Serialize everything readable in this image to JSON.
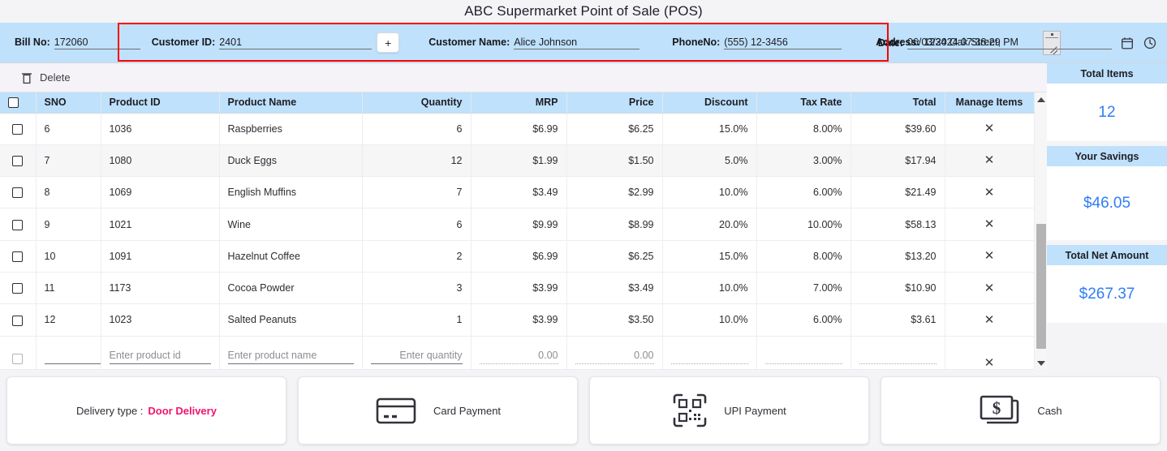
{
  "app": {
    "title": "ABC Supermarket Point of Sale (POS)"
  },
  "header": {
    "bill_no_label": "Bill No:",
    "bill_no_value": "172060",
    "customer_id_label": "Customer ID:",
    "customer_id_value": "2401",
    "add_customer_button": "+",
    "customer_name_label": "Customer Name:",
    "customer_name_value": "Alice Johnson",
    "phone_label": "PhoneNo:",
    "phone_value": "(555)  12-3456",
    "address_label": "Address:",
    "address_value": "1234 Oak Street,",
    "date_label": "Date:",
    "date_value": "06/03/2024 07:38:29 PM"
  },
  "toolbar": {
    "delete_label": "Delete"
  },
  "table": {
    "columns": [
      "SNO",
      "Product ID",
      "Product Name",
      "Quantity",
      "MRP",
      "Price",
      "Discount",
      "Tax Rate",
      "Total",
      "Manage Items"
    ],
    "rows": [
      {
        "sno": "6",
        "product_id": "1036",
        "product_name": "Raspberries",
        "quantity": "6",
        "mrp": "$6.99",
        "price": "$6.25",
        "discount": "15.0%",
        "tax_rate": "8.00%",
        "total": "$39.60",
        "remove": "✕"
      },
      {
        "sno": "7",
        "product_id": "1080",
        "product_name": "Duck Eggs",
        "quantity": "12",
        "mrp": "$1.99",
        "price": "$1.50",
        "discount": "5.0%",
        "tax_rate": "3.00%",
        "total": "$17.94",
        "remove": "✕"
      },
      {
        "sno": "8",
        "product_id": "1069",
        "product_name": "English Muffins",
        "quantity": "7",
        "mrp": "$3.49",
        "price": "$2.99",
        "discount": "10.0%",
        "tax_rate": "6.00%",
        "total": "$21.49",
        "remove": "✕"
      },
      {
        "sno": "9",
        "product_id": "1021",
        "product_name": "Wine",
        "quantity": "6",
        "mrp": "$9.99",
        "price": "$8.99",
        "discount": "20.0%",
        "tax_rate": "10.00%",
        "total": "$58.13",
        "remove": "✕"
      },
      {
        "sno": "10",
        "product_id": "1091",
        "product_name": "Hazelnut Coffee",
        "quantity": "2",
        "mrp": "$6.99",
        "price": "$6.25",
        "discount": "15.0%",
        "tax_rate": "8.00%",
        "total": "$13.20",
        "remove": "✕"
      },
      {
        "sno": "11",
        "product_id": "1173",
        "product_name": "Cocoa Powder",
        "quantity": "3",
        "mrp": "$3.99",
        "price": "$3.49",
        "discount": "10.0%",
        "tax_rate": "7.00%",
        "total": "$10.90",
        "remove": "✕"
      },
      {
        "sno": "12",
        "product_id": "1023",
        "product_name": "Salted Peanuts",
        "quantity": "1",
        "mrp": "$3.99",
        "price": "$3.50",
        "discount": "10.0%",
        "tax_rate": "6.00%",
        "total": "$3.61",
        "remove": "✕"
      }
    ],
    "input_row": {
      "sno": "",
      "product_id_placeholder": "Enter product id",
      "product_name_placeholder": "Enter product name",
      "quantity_placeholder": "Enter quantity",
      "mrp_value": "0.00",
      "price_value": "0.00",
      "discount_value": "",
      "tax_rate_value": "",
      "total_value": "",
      "remove": "✕"
    }
  },
  "summary": {
    "total_items_label": "Total Items",
    "total_items_value": "12",
    "savings_label": "Your Savings",
    "savings_value": "$46.05",
    "net_label": "Total Net Amount",
    "net_value": "$267.37"
  },
  "footer": {
    "delivery_label": "Delivery type :",
    "delivery_value": "Door Delivery",
    "card_label": "Card Payment",
    "upi_label": "UPI Payment",
    "cash_label": "Cash"
  },
  "colors": {
    "header_blue": "#bfe1fb",
    "accent_blue": "#2f7df6",
    "highlight_red": "#ff0000",
    "delivery_pink": "#f2136f",
    "page_bg": "#f4f4f6"
  }
}
